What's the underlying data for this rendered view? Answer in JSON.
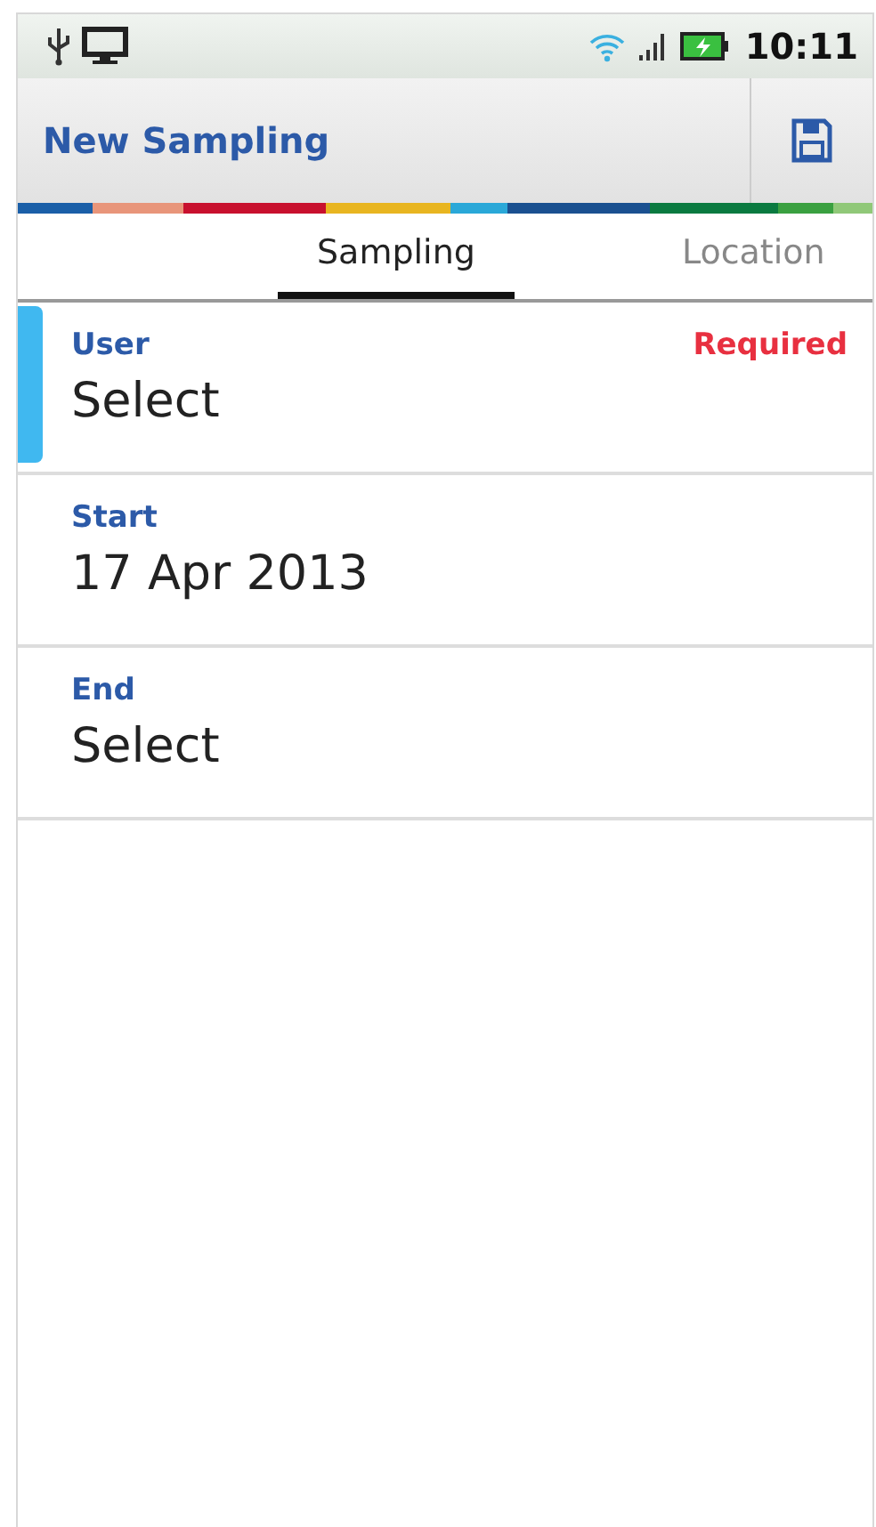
{
  "status_bar": {
    "time": "10:11"
  },
  "action_bar": {
    "title": "New Sampling"
  },
  "tabs": [
    {
      "label": "Sampling",
      "selected": true
    },
    {
      "label": "Location",
      "selected": false
    }
  ],
  "fields": [
    {
      "label": "User",
      "value": "Select",
      "required_text": "Required",
      "focused": true
    },
    {
      "label": "Start",
      "value": "17 Apr 2013",
      "focused": false
    },
    {
      "label": "End",
      "value": "Select",
      "focused": false
    }
  ]
}
